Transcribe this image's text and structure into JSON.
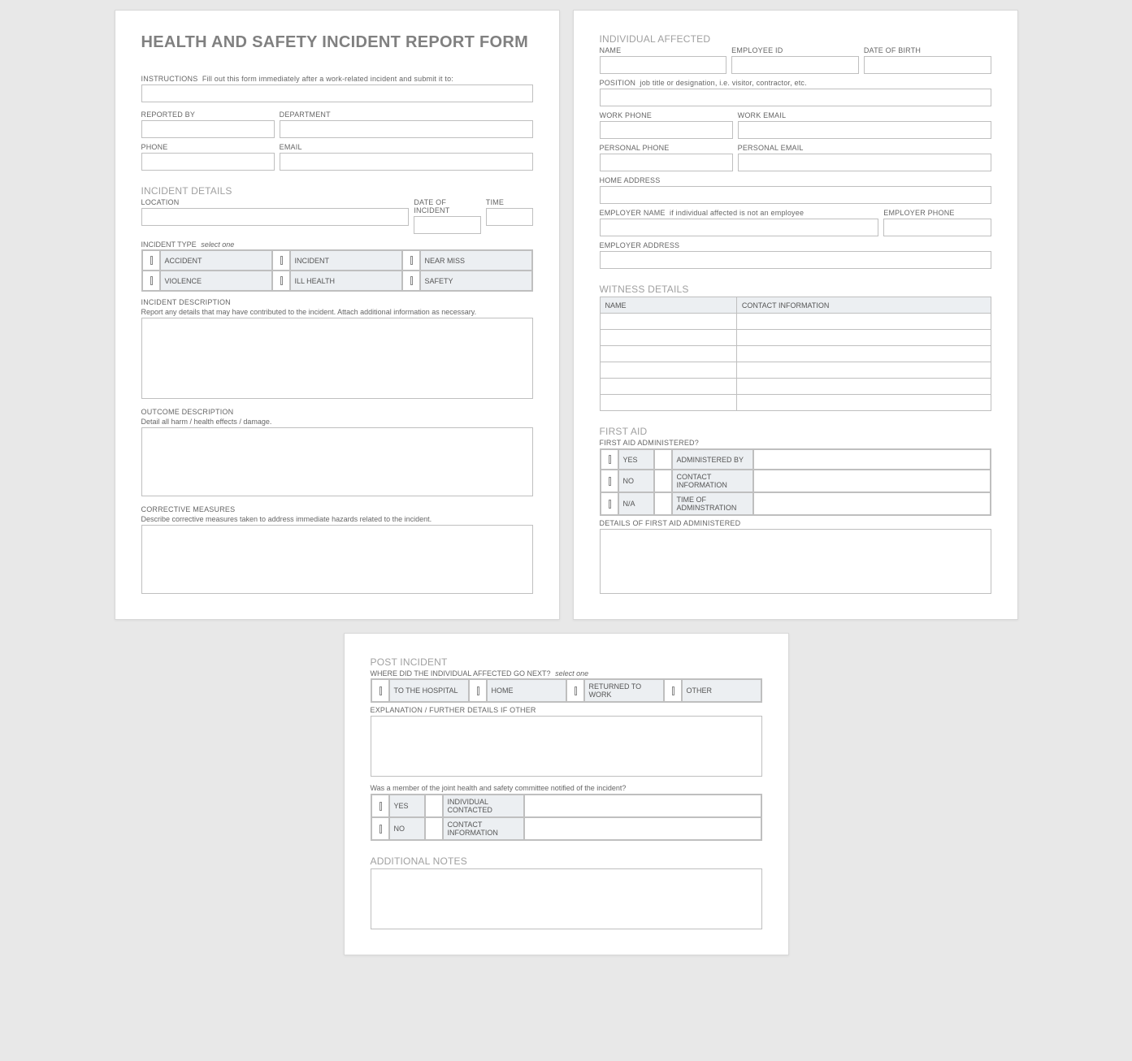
{
  "title": "HEALTH AND SAFETY INCIDENT REPORT FORM",
  "instructions": {
    "label": "INSTRUCTIONS",
    "hint": "Fill out this form immediately after a work-related incident and submit it to:"
  },
  "reported_by": "REPORTED BY",
  "department": "DEPARTMENT",
  "phone": "PHONE",
  "email": "EMAIL",
  "incident_details": {
    "heading": "INCIDENT DETAILS",
    "location": "LOCATION",
    "date": "DATE OF INCIDENT",
    "time": "TIME",
    "type_label": "INCIDENT TYPE",
    "type_hint": "select one",
    "types": [
      "ACCIDENT",
      "INCIDENT",
      "NEAR MISS",
      "VIOLENCE",
      "ILL HEALTH",
      "SAFETY"
    ],
    "desc_label": "INCIDENT DESCRIPTION",
    "desc_sub": "Report any details that may have contributed to the incident.  Attach additional information as necessary.",
    "outcome_label": "OUTCOME DESCRIPTION",
    "outcome_sub": "Detail all harm / health effects / damage.",
    "corrective_label": "CORRECTIVE MEASURES",
    "corrective_sub": "Describe corrective measures taken to address immediate hazards related to the incident."
  },
  "individual": {
    "heading": "INDIVIDUAL AFFECTED",
    "name": "NAME",
    "employee_id": "EMPLOYEE ID",
    "dob": "DATE OF BIRTH",
    "position_label": "POSITION",
    "position_hint": "job title or designation, i.e. visitor, contractor, etc.",
    "work_phone": "WORK PHONE",
    "work_email": "WORK EMAIL",
    "personal_phone": "PERSONAL PHONE",
    "personal_email": "PERSONAL EMAIL",
    "home_address": "HOME ADDRESS",
    "employer_name_label": "EMPLOYER NAME",
    "employer_name_hint": "if individual affected is not an employee",
    "employer_phone": "EMPLOYER PHONE",
    "employer_address": "EMPLOYER ADDRESS"
  },
  "witness": {
    "heading": "WITNESS DETAILS",
    "col_name": "NAME",
    "col_contact": "CONTACT INFORMATION",
    "rows": 6
  },
  "first_aid": {
    "heading": "FIRST AID",
    "question": "FIRST AID ADMINISTERED?",
    "opts": [
      "YES",
      "NO",
      "N/A"
    ],
    "admin_by": "ADMINISTERED BY",
    "contact": "CONTACT INFORMATION",
    "time": "TIME OF ADMINSTRATION",
    "details_label": "DETAILS OF FIRST AID ADMINISTERED"
  },
  "post": {
    "heading": "POST INCIDENT",
    "where_label": "WHERE DID THE INDIVIDUAL AFFECTED GO NEXT?",
    "where_hint": "select one",
    "opts": [
      "TO THE HOSPITAL",
      "HOME",
      "RETURNED TO WORK",
      "OTHER"
    ],
    "explanation": "EXPLANATION / FURTHER DETAILS IF OTHER",
    "committee_q": "Was a member of the joint health and safety committee notified of the incident?",
    "committee_opts": [
      "YES",
      "NO"
    ],
    "individual_contacted": "INDIVIDUAL CONTACTED",
    "contact_info": "CONTACT INFORMATION",
    "notes_heading": "ADDITIONAL NOTES"
  }
}
